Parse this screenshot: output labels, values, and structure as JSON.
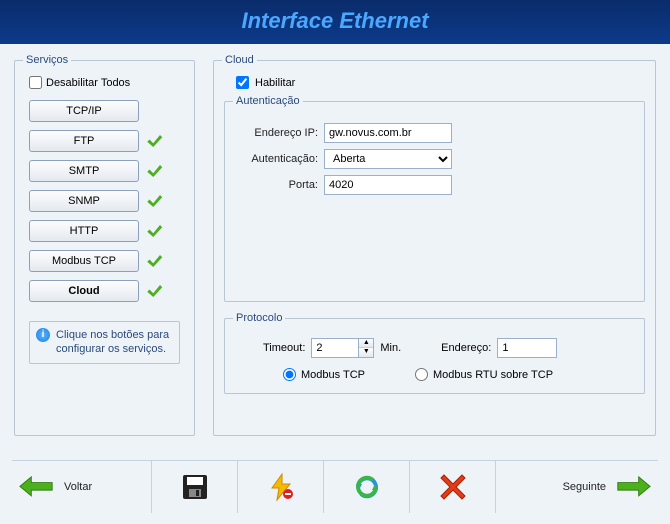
{
  "title": "Interface Ethernet",
  "services": {
    "legend": "Serviços",
    "disable_all_label": "Desabilitar Todos",
    "disable_all_checked": false,
    "items": [
      {
        "label": "TCP/IP",
        "check": false,
        "bold": false
      },
      {
        "label": "FTP",
        "check": true,
        "bold": false
      },
      {
        "label": "SMTP",
        "check": true,
        "bold": false
      },
      {
        "label": "SNMP",
        "check": true,
        "bold": false
      },
      {
        "label": "HTTP",
        "check": true,
        "bold": false
      },
      {
        "label": "Modbus TCP",
        "check": true,
        "bold": false
      },
      {
        "label": "Cloud",
        "check": true,
        "bold": true
      }
    ],
    "hint": "Clique nos botões para configurar os serviços."
  },
  "cloud": {
    "legend": "Cloud",
    "enable_label": "Habilitar",
    "enable_checked": true,
    "auth": {
      "legend": "Autenticação",
      "ip_label": "Endereço IP:",
      "ip_value": "gw.novus.com.br",
      "auth_label": "Autenticação:",
      "auth_value": "Aberta",
      "port_label": "Porta:",
      "port_value": "4020"
    },
    "proto": {
      "legend": "Protocolo",
      "timeout_label": "Timeout:",
      "timeout_value": "2",
      "timeout_unit": "Min.",
      "addr_label": "Endereço:",
      "addr_value": "1",
      "radio_modbus_tcp": "Modbus TCP",
      "radio_modbus_rtu": "Modbus RTU sobre TCP",
      "radio_selected": "tcp"
    }
  },
  "toolbar": {
    "back": "Voltar",
    "next": "Seguinte"
  },
  "icons": {
    "check": "green-check",
    "info": "i"
  }
}
